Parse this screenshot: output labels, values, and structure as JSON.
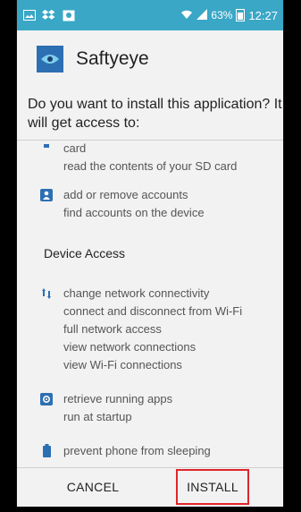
{
  "status_bar": {
    "time": "12:27",
    "battery_percent": "63%",
    "icons": [
      "image-icon",
      "dropbox-icon",
      "photo-icon",
      "wifi-icon",
      "signal-icon",
      "battery-icon"
    ]
  },
  "app": {
    "name": "Saftyeye",
    "icon": "eye-icon"
  },
  "prompt": "Do you want to install this application? It will get access to:",
  "permissions": {
    "storage": {
      "lines": [
        "card",
        "read the contents of your SD card"
      ]
    },
    "accounts": {
      "icon": "contact-card-icon",
      "lines": [
        "add or remove accounts",
        "find accounts on the device"
      ]
    },
    "device_access_title": "Device Access",
    "network": {
      "icon": "network-arrows-icon",
      "lines": [
        "change network connectivity",
        "connect and disconnect from Wi-Fi",
        "full network access",
        "view network connections",
        "view Wi-Fi connections"
      ]
    },
    "apps": {
      "icon": "gear-icon",
      "lines": [
        "retrieve running apps",
        "run at startup"
      ]
    },
    "power": {
      "icon": "battery-icon",
      "lines": [
        "prevent phone from sleeping"
      ]
    }
  },
  "buttons": {
    "cancel": "CANCEL",
    "install": "INSTALL"
  },
  "colors": {
    "status_bar": "#3aa7c6",
    "icon_blue": "#2d6fb3",
    "highlight": "#e0262a"
  }
}
